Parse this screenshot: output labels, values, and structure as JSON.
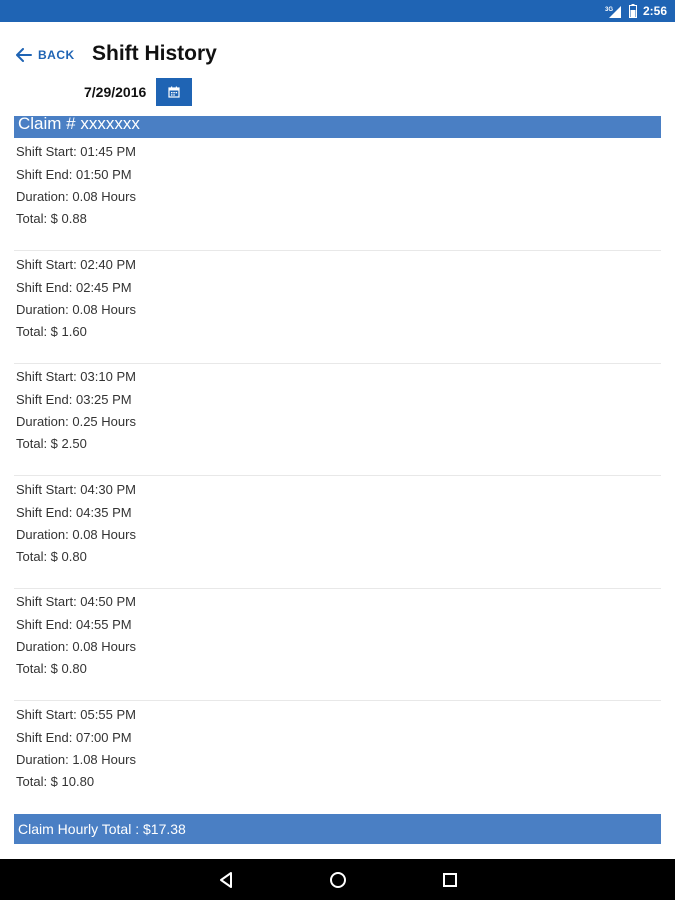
{
  "status_bar": {
    "network": "3G",
    "time": "2:56"
  },
  "header": {
    "back_label": "BACK",
    "title": "Shift History"
  },
  "date_picker": {
    "date": "7/29/2016"
  },
  "claim": {
    "header": "Claim # xxxxxxx"
  },
  "shifts": [
    {
      "start": "Shift Start: 01:45 PM",
      "end": "Shift End: 01:50 PM",
      "duration": "Duration: 0.08 Hours",
      "total": "Total: $ 0.88"
    },
    {
      "start": "Shift Start: 02:40 PM",
      "end": "Shift End: 02:45 PM",
      "duration": "Duration: 0.08 Hours",
      "total": "Total: $ 1.60"
    },
    {
      "start": "Shift Start: 03:10 PM",
      "end": "Shift End: 03:25 PM",
      "duration": "Duration: 0.25 Hours",
      "total": "Total: $ 2.50"
    },
    {
      "start": "Shift Start: 04:30 PM",
      "end": "Shift End: 04:35 PM",
      "duration": "Duration: 0.08 Hours",
      "total": "Total: $ 0.80"
    },
    {
      "start": "Shift Start: 04:50 PM",
      "end": "Shift End: 04:55 PM",
      "duration": "Duration: 0.08 Hours",
      "total": "Total: $ 0.80"
    },
    {
      "start": "Shift Start: 05:55 PM",
      "end": "Shift End: 07:00 PM",
      "duration": "Duration: 1.08 Hours",
      "total": "Total: $ 10.80"
    }
  ],
  "summary": {
    "total": "Claim Hourly Total : $17.38"
  },
  "nav": {
    "back_icon": "triangle-back-icon",
    "home_icon": "circle-home-icon",
    "recents_icon": "square-recents-icon"
  },
  "colors": {
    "accent": "#1f64b4",
    "header_bar": "#4a7fc4"
  }
}
